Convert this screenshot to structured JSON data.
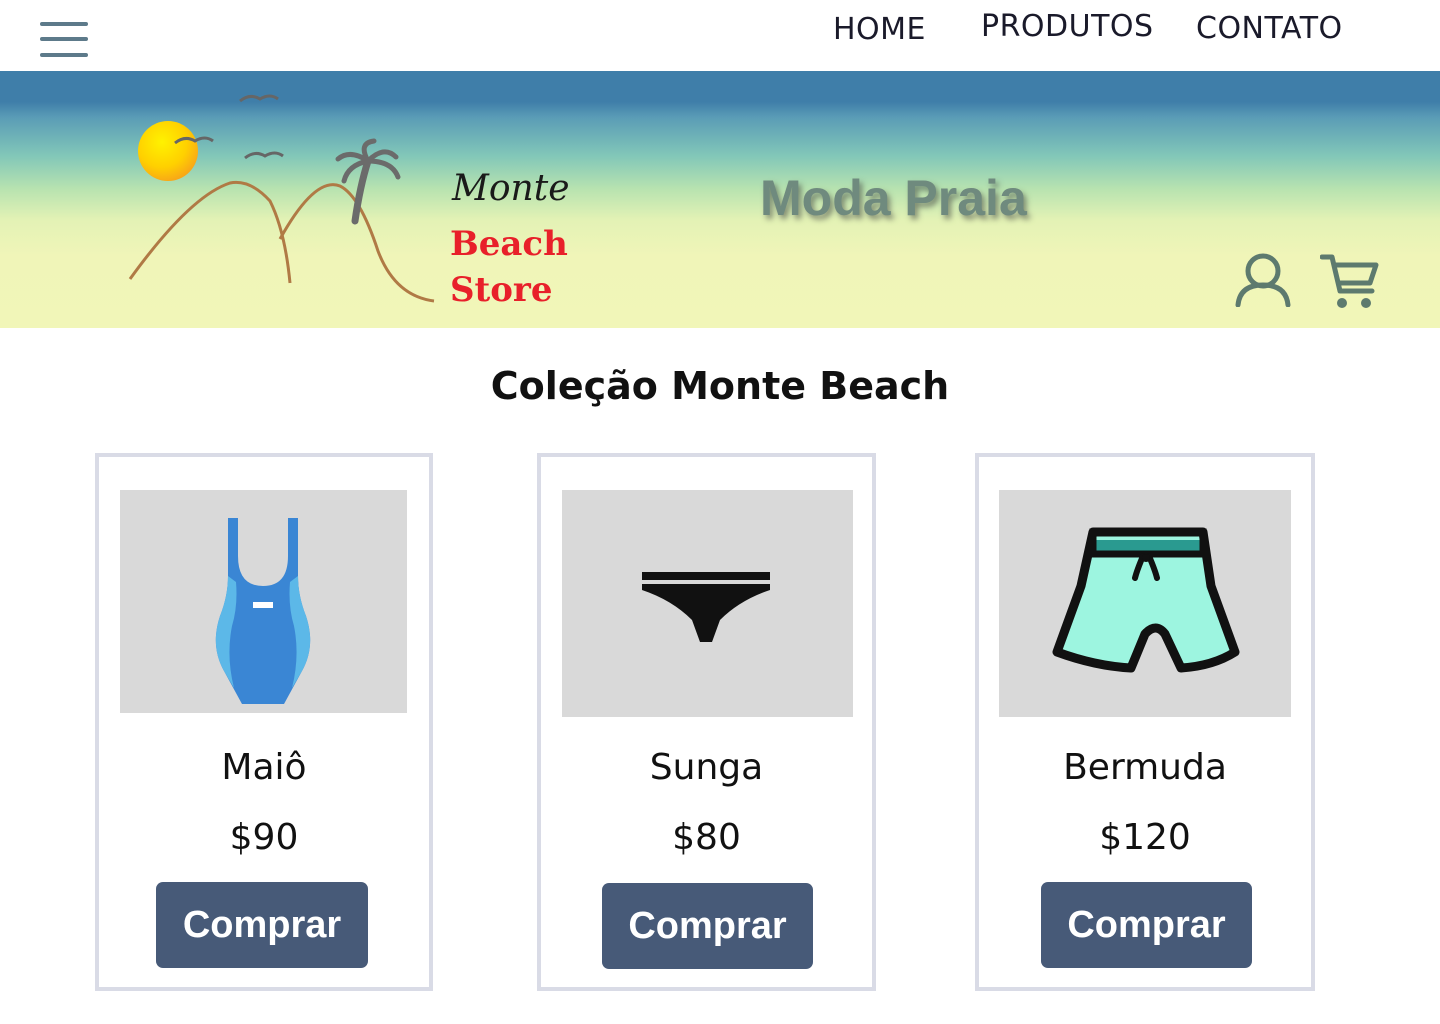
{
  "nav": {
    "menu_icon": "hamburger-menu-icon",
    "links": [
      {
        "label": "HOME"
      },
      {
        "label": "PRODUTOS"
      },
      {
        "label": "CONTATO"
      }
    ]
  },
  "banner": {
    "logo": {
      "line1": "Monte",
      "line2": "Beach",
      "line3": "Store"
    },
    "tagline": "Moda Praia",
    "user_icon": "user-icon",
    "cart_icon": "shopping-cart-icon"
  },
  "main": {
    "title": "Coleção Monte Beach",
    "products": [
      {
        "name": "Maiô",
        "price": "$90",
        "button": "Comprar",
        "icon": "swimsuit-icon"
      },
      {
        "name": "Sunga",
        "price": "$80",
        "button": "Comprar",
        "icon": "swim-briefs-icon"
      },
      {
        "name": "Bermuda",
        "price": "$120",
        "button": "Comprar",
        "icon": "board-shorts-icon"
      }
    ]
  },
  "colors": {
    "button": "#475a78",
    "card_border": "#d9dbe6",
    "image_bg": "#d9d9d9",
    "logo_red": "#e8202a",
    "banner_top": "#3f7ea9",
    "banner_bottom": "#f1f6b8"
  }
}
